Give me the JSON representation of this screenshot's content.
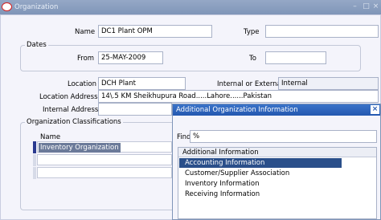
{
  "window": {
    "title": "Organization"
  },
  "form": {
    "name_label": "Name",
    "name_value": "DC1 Plant OPM",
    "type_label": "Type",
    "type_value": "",
    "dates": {
      "title": "Dates",
      "from_label": "From",
      "from_value": "25-MAY-2009",
      "to_label": "To",
      "to_value": ""
    },
    "location_label": "Location",
    "location_value": "DCH Plant",
    "internal_external_label": "Internal or External",
    "internal_external_value": "Internal",
    "location_address_label": "Location Address",
    "location_address_value": "14\\.5 KM Sheikhupura Road.....Lahore......Pakistan",
    "internal_address_label": "Internal Address",
    "internal_address_value": ""
  },
  "classifications": {
    "title": "Organization Classifications",
    "name_header": "Name",
    "rows": [
      "Inventory Organization",
      "",
      ""
    ]
  },
  "dialog": {
    "title": "Additional Organization Information",
    "find_label": "Find",
    "find_value": "%",
    "list_header": "Additional Information",
    "items": [
      "Accounting Information",
      "Customer/Supplier Association",
      "Inventory Information",
      "Receiving Information"
    ],
    "selected_index": 0
  }
}
